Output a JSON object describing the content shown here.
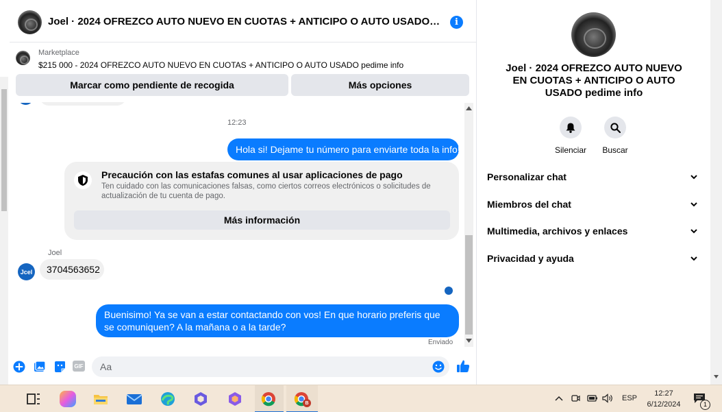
{
  "header": {
    "title": "Joel · 2024 OFREZCO AUTO NUEVO EN CUOTAS + ANTICIPO O AUTO USADO pe...",
    "info_icon": "info-icon"
  },
  "marketplace": {
    "label": "Marketplace",
    "listing": "$215 000 - 2024 OFREZCO AUTO NUEVO EN CUOTAS + ANTICIPO O AUTO USADO pedime info"
  },
  "actions": {
    "pending_pickup": "Marcar como pendiente de recogida",
    "more_options": "Más opciones"
  },
  "conversation": {
    "timestamp": "12:23",
    "msg_out_1": "Hola si! Dejame tu número para enviarte toda la info!",
    "warning": {
      "title": "Precaución con las estafas comunes al usar aplicaciones de pago",
      "body": "Ten cuidado con las comunicaciones falsas, como ciertos correos electrónicos o solicitudes de actualización de tu cuenta de pago.",
      "button": "Más información"
    },
    "sender_name": "Joel",
    "avatar_text": "Jcel",
    "msg_in_1": "3704563652",
    "msg_out_2": "Buenisimo! Ya se van a estar contactando con vos! En que horario preferis que se comuniquen? A la mañana o a la tarde?",
    "status": "Enviado"
  },
  "composer": {
    "placeholder": "Aa",
    "gif_label": "GIF"
  },
  "info_panel": {
    "title": "Joel · 2024 OFREZCO AUTO NUEVO EN CUOTAS + ANTICIPO O AUTO USADO pedime info",
    "mute_label": "Silenciar",
    "search_label": "Buscar",
    "sections": [
      "Personalizar chat",
      "Miembros del chat",
      "Multimedia, archivos y enlaces",
      "Privacidad y ayuda"
    ]
  },
  "taskbar": {
    "language": "ESP",
    "time": "12:27",
    "date": "6/12/2024",
    "notification_count": "1",
    "chrome_badge": "B"
  },
  "colors": {
    "messenger_blue": "#0a7cff",
    "bubble_grey": "#f0f0f0",
    "taskbar": "#f3e7d8"
  }
}
